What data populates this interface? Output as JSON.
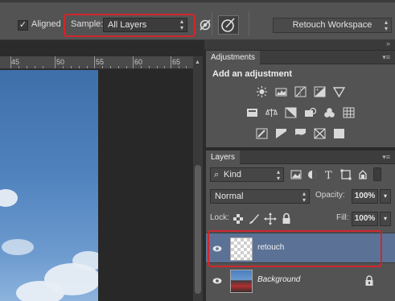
{
  "options_bar": {
    "aligned_checked": "✓",
    "aligned_label": "Aligned",
    "sample_label": "Sample:",
    "sample_value": "All Layers",
    "workspace_value": "Retouch Workspace"
  },
  "ruler": {
    "labels": [
      "45",
      "50",
      "55",
      "60",
      "65"
    ]
  },
  "adjustments_panel": {
    "tab_label": "Adjustments",
    "title": "Add an adjustment",
    "rows": [
      [
        "brightness-contrast-icon",
        "levels-icon",
        "curves-icon",
        "exposure-icon",
        "vibrance-icon"
      ],
      [
        "hue-saturation-icon",
        "color-balance-icon",
        "black-white-icon",
        "photo-filter-icon",
        "channel-mixer-icon",
        "color-lookup-icon"
      ],
      [
        "invert-icon",
        "posterize-icon",
        "threshold-icon",
        "selective-color-icon",
        "gradient-map-icon"
      ]
    ]
  },
  "layers_panel": {
    "tab_label": "Layers",
    "filter_label": "Kind",
    "blend_mode": "Normal",
    "opacity_label": "Opacity:",
    "opacity_value": "100%",
    "lock_label": "Lock:",
    "fill_label": "Fill:",
    "fill_value": "100%",
    "layers": [
      {
        "name": "retouch",
        "selected": true
      },
      {
        "name": "Background",
        "selected": false,
        "locked": true
      }
    ]
  },
  "colors": {
    "highlight_red": "#d0262e",
    "selected_layer": "#5b7296",
    "panel_bg": "#535353",
    "options_bar_bg": "#535353"
  }
}
